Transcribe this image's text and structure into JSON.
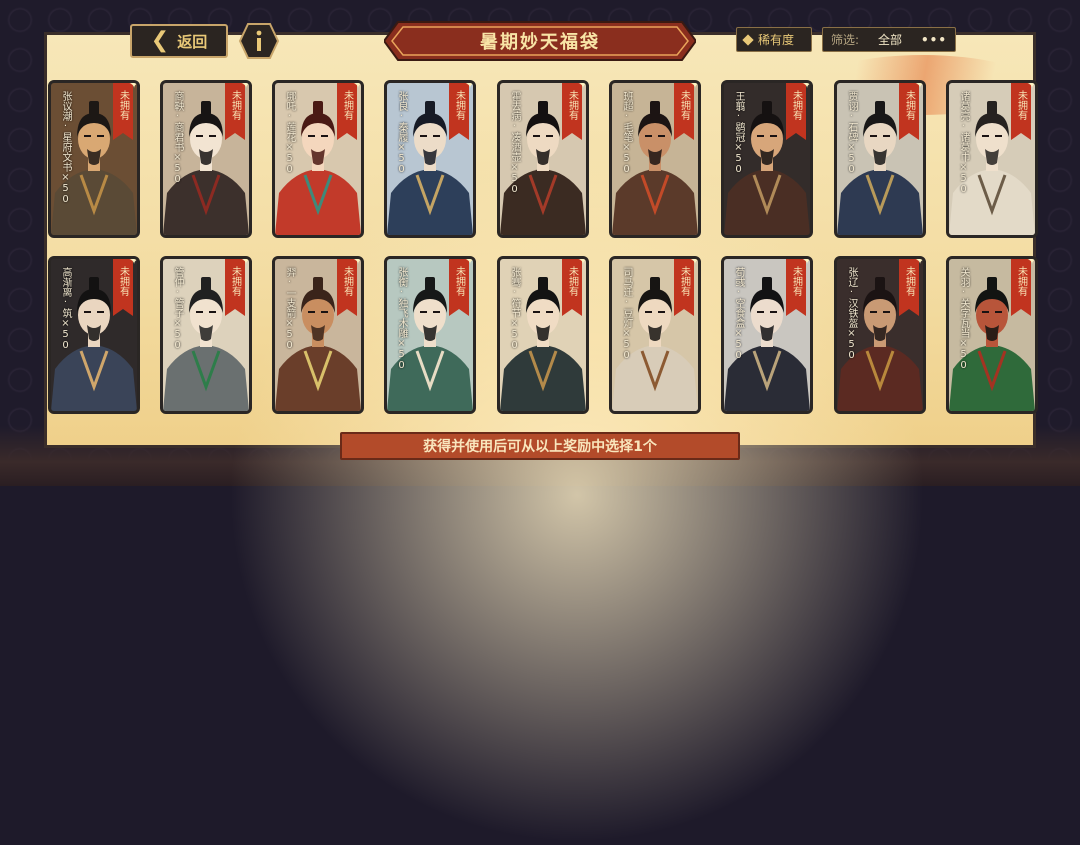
{
  "header": {
    "back_label": "返回",
    "title": "暑期妙天福袋",
    "rarity_label": "稀有度",
    "filter_label": "筛选:",
    "filter_value": "全部",
    "more_label": "•••"
  },
  "cards": [
    {
      "name": "张议潮·星府文书×50",
      "tag": "未拥有",
      "bg": "#6b4e34",
      "robe": "#5a4a36",
      "hair": "#1d1815",
      "accent": "#b88a45",
      "skin": "#d9a873"
    },
    {
      "name": "商鞅·商君书×50",
      "tag": "未拥有",
      "bg": "#c7b49a",
      "robe": "#3c302c",
      "hair": "#171414",
      "accent": "#8c2a22",
      "skin": "#f2e4d2"
    },
    {
      "name": "哪吒·莲花×50",
      "tag": "未拥有",
      "bg": "#d8c8ae",
      "robe": "#c23a2a",
      "hair": "#4a1a14",
      "accent": "#3f8a7a",
      "skin": "#f4d7bd"
    },
    {
      "name": "张良·秦履×50",
      "tag": "未拥有",
      "bg": "#b8c6d2",
      "robe": "#2d3f5a",
      "hair": "#161a25",
      "accent": "#c4a464",
      "skin": "#ecdcc8"
    },
    {
      "name": "霍去病·凑酒壶×50",
      "tag": "未拥有",
      "bg": "#d6c8b0",
      "robe": "#3b2b22",
      "hair": "#141010",
      "accent": "#a33a28",
      "skin": "#eedac2"
    },
    {
      "name": "班超·毛笔×50",
      "tag": "未拥有",
      "bg": "#c6b496",
      "robe": "#5b3a2a",
      "hair": "#1c1413",
      "accent": "#c24a28",
      "skin": "#c99068"
    },
    {
      "name": "王翦·鹖冠×50",
      "tag": "未拥有",
      "bg": "#332c2a",
      "robe": "#4a2e24",
      "hair": "#151111",
      "accent": "#b08a58",
      "skin": "#d7a67a"
    },
    {
      "name": "贾诩·石碑×50",
      "tag": "未拥有",
      "bg": "#c9c3b4",
      "robe": "#2e3a52",
      "hair": "#181717",
      "accent": "#b89a5a",
      "skin": "#e8d7c2"
    },
    {
      "name": "诸葛亮·诸葛巾×50",
      "tag": "未拥有",
      "bg": "#d6ccb8",
      "robe": "#e3dac8",
      "hair": "#262220",
      "accent": "#6c5c48",
      "skin": "#efe0cc"
    },
    {
      "name": "高渐离·筑×50",
      "tag": "未拥有",
      "bg": "#2f2a2a",
      "robe": "#3a4458",
      "hair": "#131212",
      "accent": "#cfa66b",
      "skin": "#ead6c0"
    },
    {
      "name": "管仲·管子×50",
      "tag": "未拥有",
      "bg": "#ddd2bc",
      "robe": "#6a7070",
      "hair": "#202020",
      "accent": "#2e7d4a",
      "skin": "#f1e2cf"
    },
    {
      "name": "羿·一支箭×50",
      "tag": "未拥有",
      "bg": "#c9b69c",
      "robe": "#6a3e2a",
      "hair": "#3a241a",
      "accent": "#d8c06a",
      "skin": "#c98e60"
    },
    {
      "name": "张衡·独飞木雕×50",
      "tag": "未拥有",
      "bg": "#b7c8c0",
      "robe": "#3f6a5a",
      "hair": "#161818",
      "accent": "#e7dcc4",
      "skin": "#efdfcb"
    },
    {
      "name": "张骞·符节×50",
      "tag": "未拥有",
      "bg": "#e0d2b6",
      "robe": "#2f3a3a",
      "hair": "#131313",
      "accent": "#b38a4a",
      "skin": "#f0dcc4"
    },
    {
      "name": "司马迁·豆灯×50",
      "tag": "未拥有",
      "bg": "#d6c6a8",
      "robe": "#d8ccb8",
      "hair": "#171513",
      "accent": "#8c5a32",
      "skin": "#eed9c0"
    },
    {
      "name": "荀彧·空食盒×50",
      "tag": "未拥有",
      "bg": "#c9c6c0",
      "robe": "#2a2c36",
      "hair": "#121214",
      "accent": "#b9a37a",
      "skin": "#ecdccd"
    },
    {
      "name": "张辽·汉铁盔×50",
      "tag": "未拥有",
      "bg": "#3a2e2c",
      "robe": "#5b2a22",
      "hair": "#1b1313",
      "accent": "#b9883c",
      "skin": "#c99a74"
    },
    {
      "name": "关羽·关字瓦当×50",
      "tag": "未拥有",
      "bg": "#c6baa0",
      "robe": "#2f6a3a",
      "hair": "#121412",
      "accent": "#a33322",
      "skin": "#b8553a"
    }
  ],
  "hint": "获得并使用后可从以上奖励中选择1个"
}
